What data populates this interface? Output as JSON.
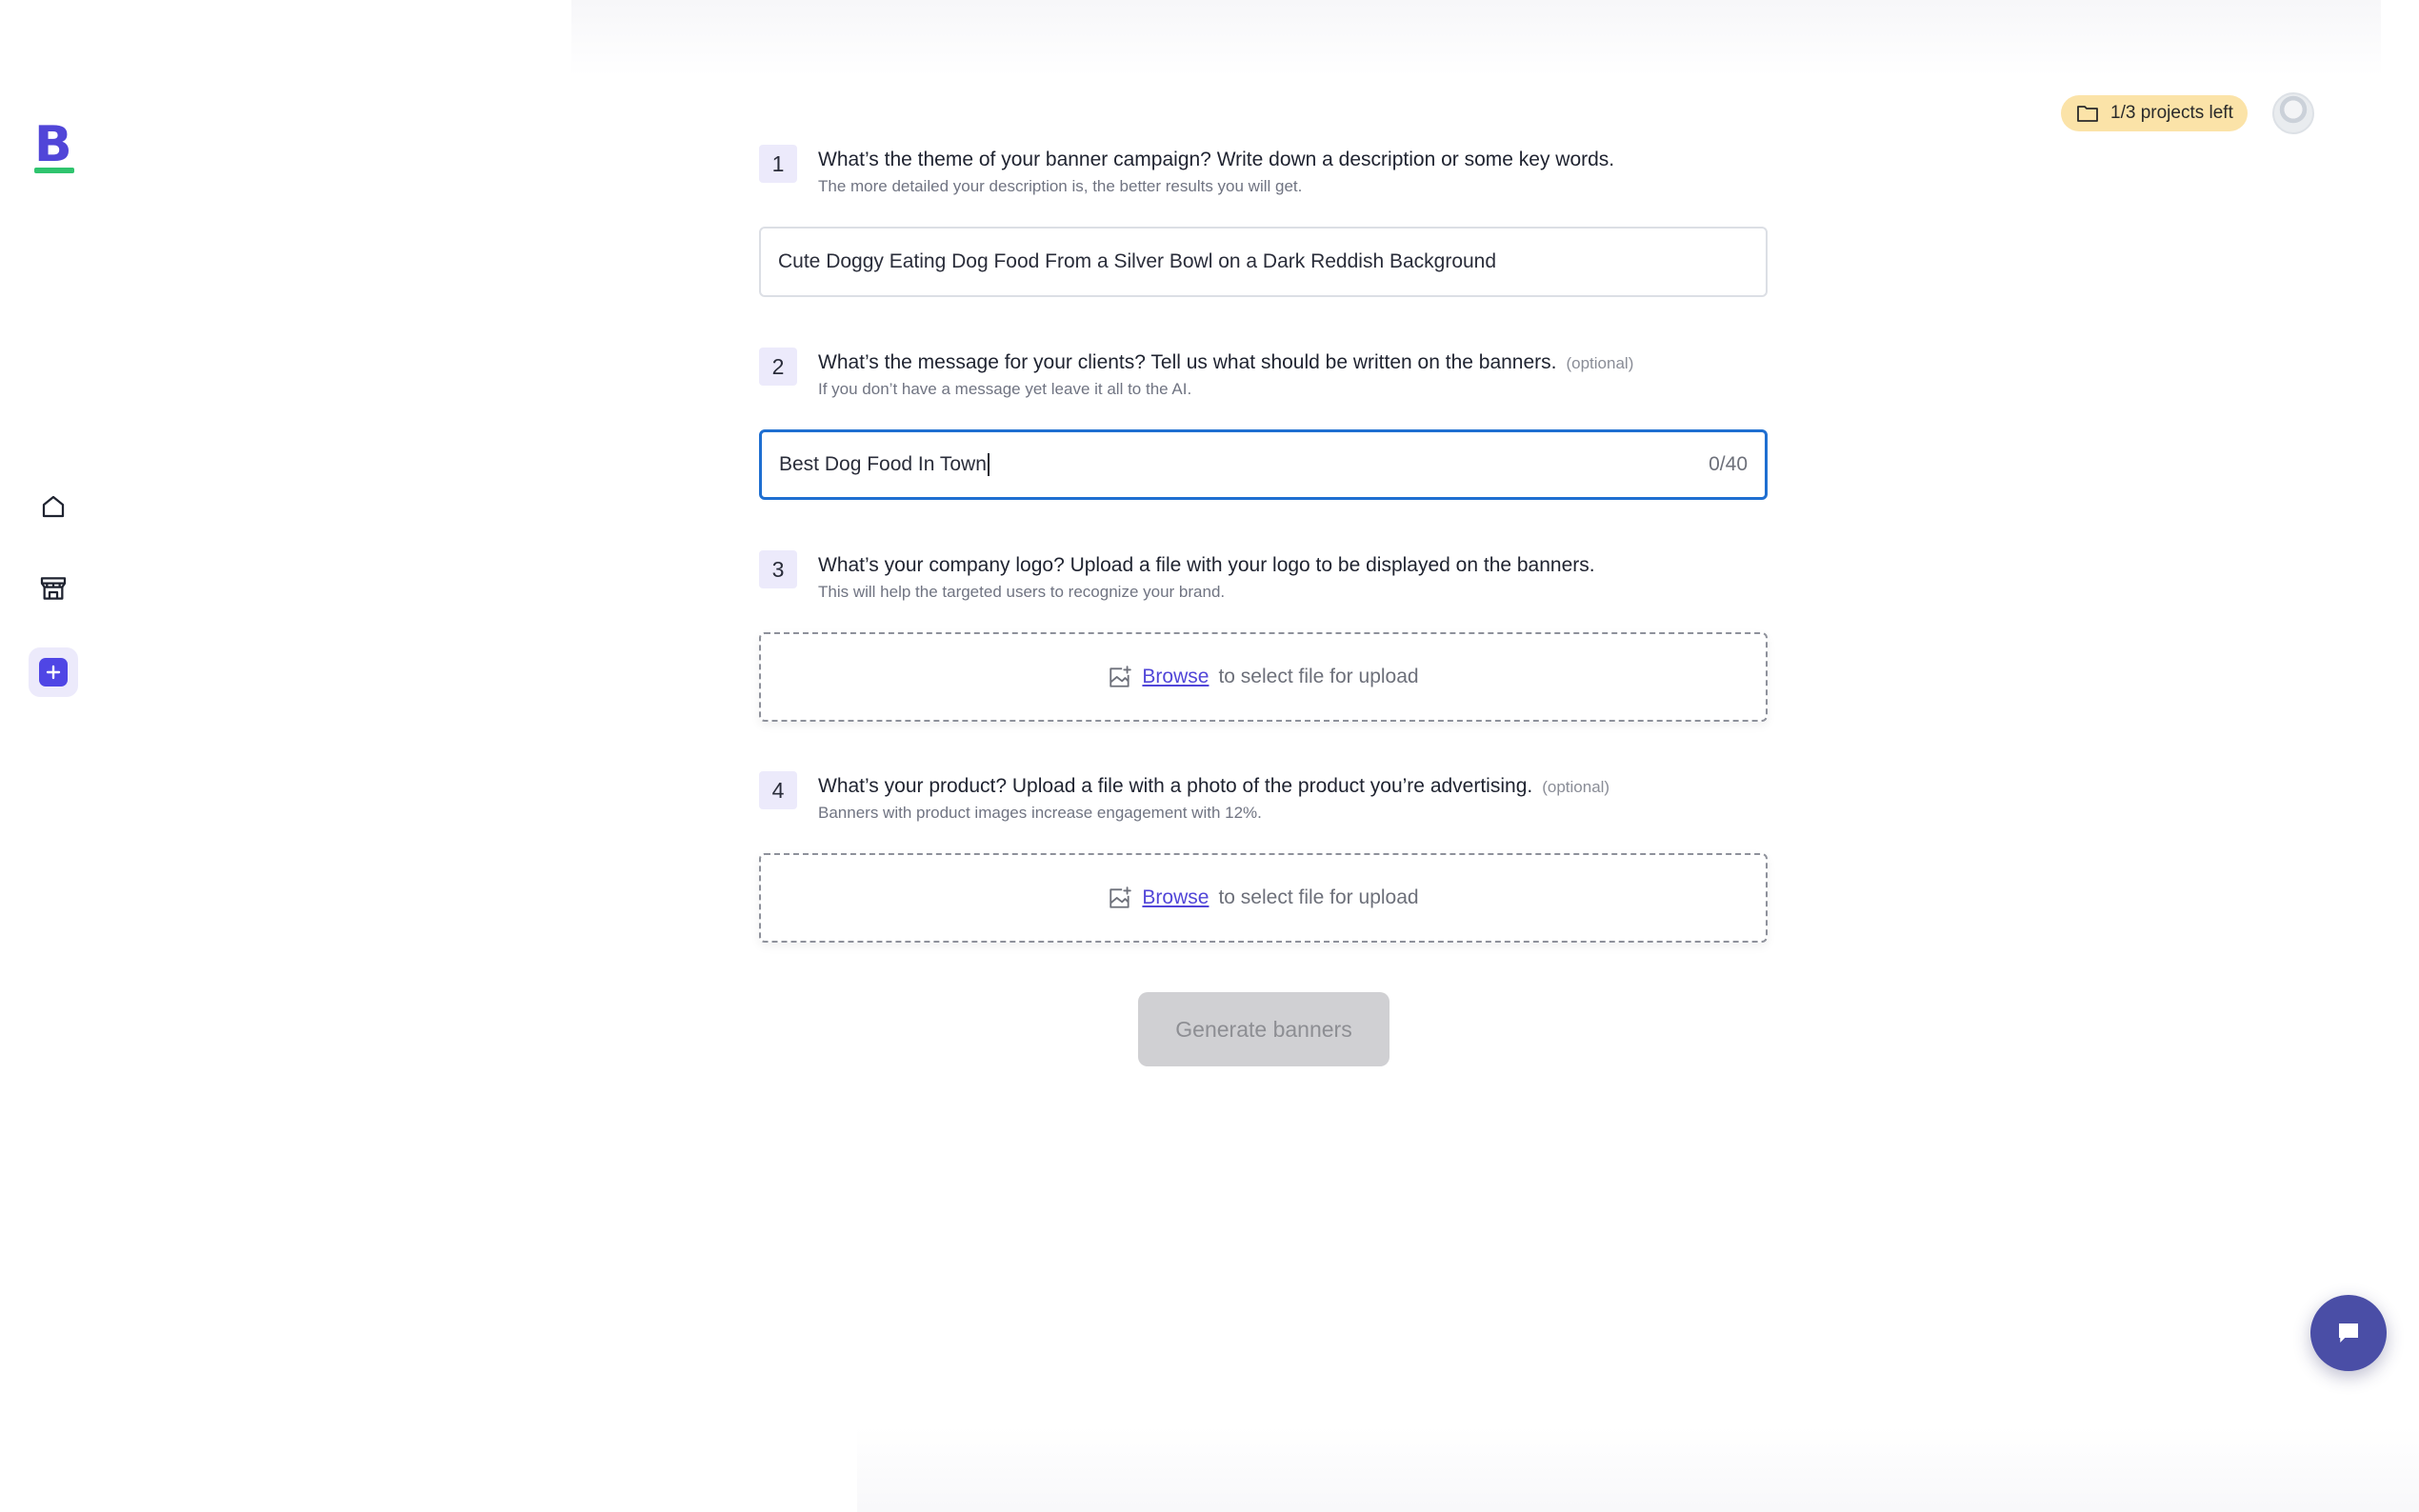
{
  "sidebar": {
    "logo_letter": "B",
    "items": [
      {
        "name": "home",
        "icon": "home-icon"
      },
      {
        "name": "store",
        "icon": "store-icon"
      },
      {
        "name": "new-project",
        "icon": "plus-icon"
      }
    ]
  },
  "header": {
    "projects_left": "1/3 projects left",
    "projects_icon": "folder-icon"
  },
  "steps": [
    {
      "number": "1",
      "title": "What’s the theme of your banner campaign? Write down a description or some key words.",
      "subtitle": "The more detailed your description is, the better results you will get.",
      "input_value": "Cute Doggy Eating Dog Food From a Silver Bowl on a Dark Reddish Background"
    },
    {
      "number": "2",
      "title": "What’s the message for your clients? Tell us what should be written on the banners.",
      "optional": "(optional)",
      "subtitle": "If you don’t have a message yet leave it all to the AI.",
      "input_value": "Best Dog Food In Town",
      "counter": "0/40"
    },
    {
      "number": "3",
      "title": "What’s your company logo? Upload a file with your logo to be displayed on the banners.",
      "subtitle": "This will help the targeted users to recognize your brand.",
      "upload_link": "Browse",
      "upload_text": "to select file for upload"
    },
    {
      "number": "4",
      "title": "What’s your product? Upload a file with a photo of the product you’re advertising.",
      "optional": "(optional)",
      "subtitle": "Banners with product images increase engagement with 12%.",
      "upload_link": "Browse",
      "upload_text": "to select file for upload"
    }
  ],
  "generate_button": "Generate banners",
  "colors": {
    "brand": "#5146d8",
    "logo_underline": "#2fc46e",
    "focus_border": "#1f6fd1",
    "badge_bg": "#fbe3a8",
    "chat_fab": "#4a4ea6",
    "disabled_button": "#d0d0d3"
  }
}
